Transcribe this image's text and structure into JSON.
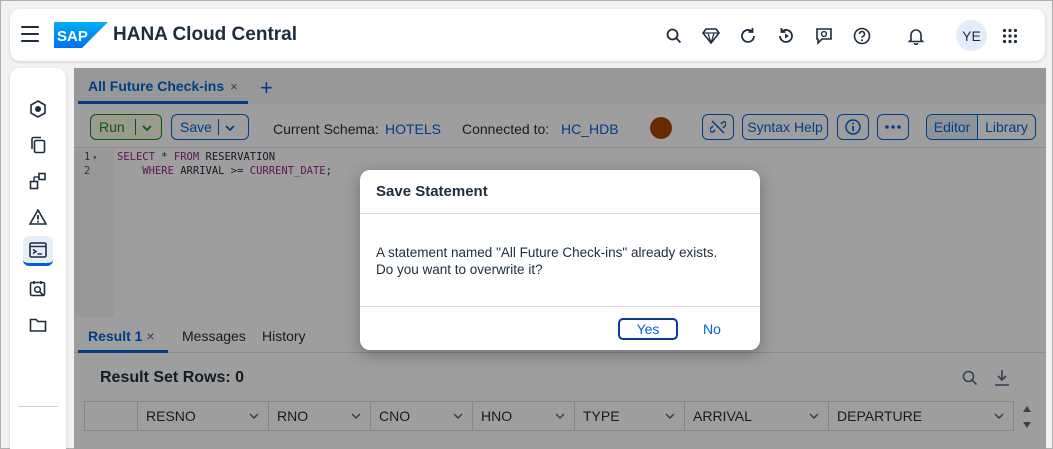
{
  "shell": {
    "logo_text": "SAP",
    "title": "HANA Cloud Central",
    "avatar_initials": "YE",
    "icons": [
      "search-icon",
      "diamond-icon",
      "refresh-icon",
      "history-icon",
      "feedback-icon",
      "help-icon",
      "notification-bell-icon",
      "app-grid-icon"
    ]
  },
  "sidenav": {
    "items": [
      "instances-icon",
      "copy-icon",
      "database-objects-icon",
      "alerts-icon",
      "sql-console-icon",
      "analyzer-icon",
      "folder-icon"
    ],
    "active": "sql-console-icon"
  },
  "tabs": [
    {
      "label": "All Future Check-ins",
      "close": "×"
    }
  ],
  "tab_add": "+",
  "toolbar": {
    "run_label": "Run",
    "save_label": "Save",
    "schema_label": "Current Schema:",
    "schema_value": "HOTELS",
    "connected_label": "Connected to:",
    "connected_value": "HC_HDB",
    "syntax_help_label": "Syntax Help",
    "editor_label": "Editor",
    "library_label": "Library"
  },
  "editor": {
    "lines": [
      {
        "num": "1",
        "fold": "▾",
        "kw1": "SELECT",
        "mid1": " * ",
        "kw2": "FROM",
        "rest": " RESERVATION"
      },
      {
        "num": "2",
        "indent": "    ",
        "kw1": "WHERE",
        "mid1": " ARRIVAL >= ",
        "kw2": "CURRENT_DATE",
        "rest": ";"
      }
    ]
  },
  "result_tabs": [
    {
      "label": "Result 1",
      "close": "×"
    },
    {
      "label": "Messages"
    },
    {
      "label": "History"
    }
  ],
  "result": {
    "title": "Result Set Rows: 0",
    "columns": [
      "RESNO",
      "RNO",
      "CNO",
      "HNO",
      "TYPE",
      "ARRIVAL",
      "DEPARTURE"
    ]
  },
  "dialog": {
    "title": "Save Statement",
    "message_line1": "A statement named \"All Future Check-ins\" already exists.",
    "message_line2": "Do you want to overwrite it?",
    "yes_label": "Yes",
    "no_label": "No"
  },
  "colors": {
    "accent": "#0064d9",
    "run_green": "#188918",
    "status_dot": "#a54800",
    "keyword": "#93268f"
  }
}
